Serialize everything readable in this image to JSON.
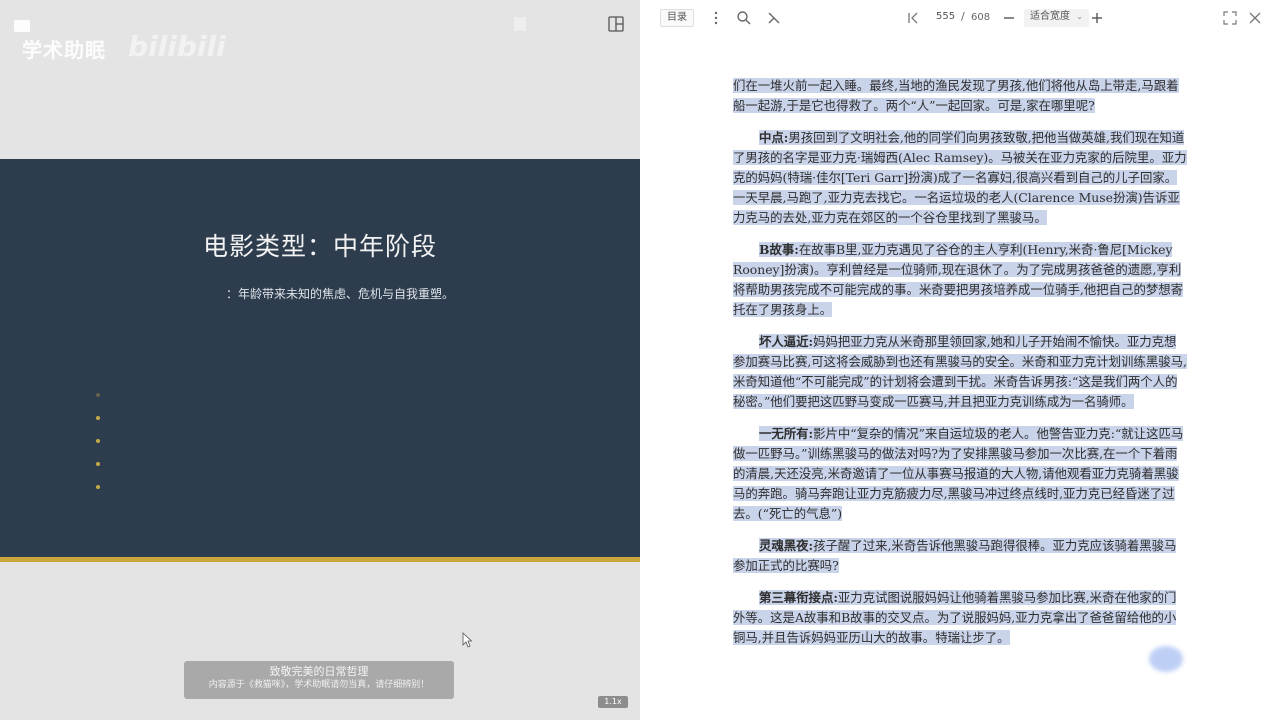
{
  "video": {
    "watermark_text": "学术助眠",
    "watermark_brand": "bilibili",
    "slide_title": "电影类型：中年阶段",
    "slide_subtitle": "：年龄带来未知的焦虑、危机与自我重塑。",
    "bullet_count": 5,
    "caption_line1": "致敬完美的日常哲理",
    "caption_line2": "内容源于《救猫咪》，学术助眠请勿当真，请仔细辨别！",
    "corner_badge": "1.1x",
    "colors": {
      "slide_bg": "#2e3d4e",
      "accent_gold": "#c9a63a"
    }
  },
  "reader": {
    "toolbar": {
      "outline_label": "目录",
      "page_current": "555",
      "page_separator": "/",
      "page_total": "608",
      "zoom_label": "适合宽度"
    },
    "paragraphs": [
      {
        "label": "",
        "text": "们在一堆火前一起入睡。最终,当地的渔民发现了男孩,他们将他从岛上带走,马跟着船一起游,于是它也得救了。两个“人”一起回家。可是,家在哪里呢?"
      },
      {
        "label": "中点:",
        "text": "男孩回到了文明社会,他的同学们向男孩致敬,把他当做英雄,我们现在知道了男孩的名字是亚力克·瑞姆西(Alec Ramsey)。马被关在亚力克家的后院里。亚力克的妈妈(特瑞·佳尔[Teri Garr]扮演)成了一名寡妇,很高兴看到自己的儿子回家。一天早晨,马跑了,亚力克去找它。一名运垃圾的老人(Clarence Muse扮演)告诉亚力克马的去处,亚力克在郊区的一个谷仓里找到了黑骏马。"
      },
      {
        "label": "B故事:",
        "text": "在故事B里,亚力克遇见了谷仓的主人亨利(Henry,米奇·鲁尼[Mickey Rooney]扮演)。亨利曾经是一位骑师,现在退休了。为了完成男孩爸爸的遗愿,亨利将帮助男孩完成不可能完成的事。米奇要把男孩培养成一位骑手,他把自己的梦想寄托在了男孩身上。"
      },
      {
        "label": "坏人逼近:",
        "text": "妈妈把亚力克从米奇那里领回家,她和儿子开始闹不愉快。亚力克想参加赛马比赛,可这将会威胁到也还有黑骏马的安全。米奇和亚力克计划训练黑骏马,米奇知道他“不可能完成”的计划将会遭到干扰。米奇告诉男孩:“这是我们两个人的秘密。”他们要把这匹野马变成一匹赛马,并且把亚力克训练成为一名骑师。"
      },
      {
        "label": "一无所有:",
        "text": "影片中“复杂的情况”来自运垃圾的老人。他警告亚力克:“就让这匹马做一匹野马。”训练黑骏马的做法对吗?为了安排黑骏马参加一次比赛,在一个下着雨的清晨,天还没亮,米奇邀请了一位从事赛马报道的大人物,请他观看亚力克骑着黑骏马的奔跑。骑马奔跑让亚力克筋疲力尽,黑骏马冲过终点线时,亚力克已经昏迷了过去。(“死亡的气息”)"
      },
      {
        "label": "灵魂黑夜:",
        "text": "孩子醒了过来,米奇告诉他黑骏马跑得很棒。亚力克应该骑着黑骏马参加正式的比赛吗?"
      },
      {
        "label": "第三幕衔接点:",
        "text": "亚力克试图说服妈妈让他骑着黑骏马参加比赛,米奇在他家的门外等。这是A故事和B故事的交叉点。为了说服妈妈,亚力克拿出了爸爸留给他的小铜马,并且告诉妈妈亚历山大的故事。特瑞让步了。"
      }
    ],
    "colors": {
      "highlight": "#c9d3ea"
    }
  }
}
